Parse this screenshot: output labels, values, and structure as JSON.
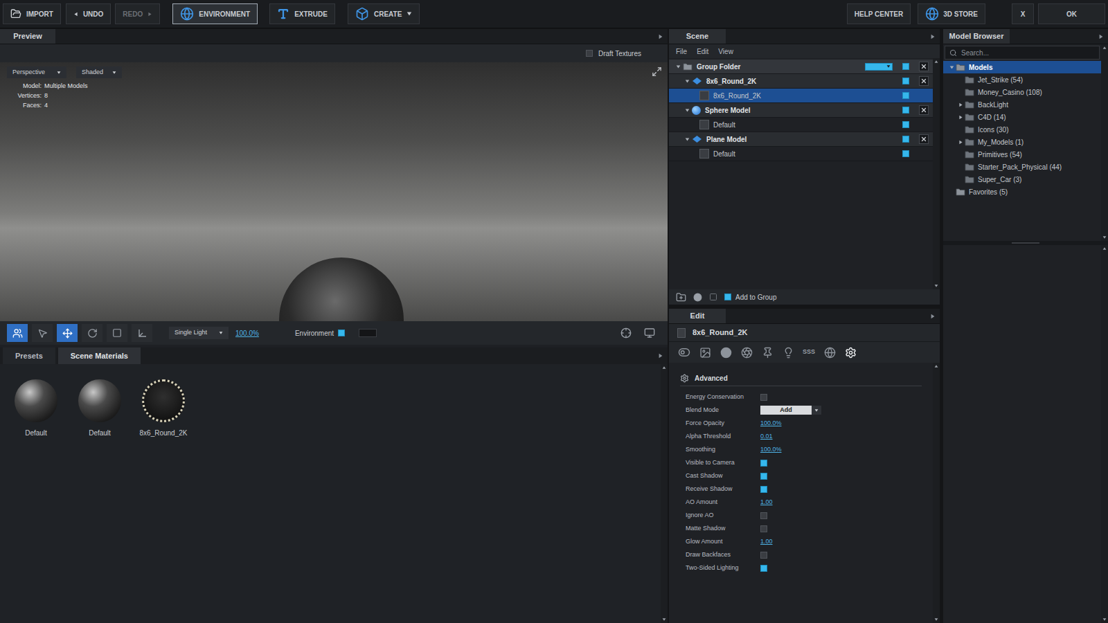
{
  "toolbar": {
    "left": [
      {
        "label": "IMPORT",
        "selected": false,
        "disabled": false,
        "dropdown": false
      },
      {
        "label": "UNDO",
        "selected": false,
        "disabled": false,
        "dropdown": false
      },
      {
        "label": "REDO",
        "selected": false,
        "disabled": true,
        "dropdown": false
      },
      {
        "label": "ENVIRONMENT",
        "selected": true,
        "disabled": false,
        "dropdown": false
      },
      {
        "label": "EXTRUDE",
        "selected": false,
        "disabled": false,
        "dropdown": false
      },
      {
        "label": "CREATE",
        "selected": false,
        "disabled": false,
        "dropdown": true
      }
    ],
    "right": [
      {
        "label": "HELP CENTER"
      },
      {
        "label": "3D STORE"
      },
      {
        "label": "X"
      },
      {
        "label": "OK"
      }
    ]
  },
  "preview": {
    "tab": "Preview",
    "draft_textures": {
      "label": "Draft Textures",
      "checked": false
    },
    "view_mode": "Perspective",
    "shading": "Shaded",
    "info": [
      {
        "label": "Model:",
        "value": "Multiple Models"
      },
      {
        "label": "Vertices:",
        "value": "8"
      },
      {
        "label": "Faces:",
        "value": "4"
      }
    ],
    "tools": [
      {
        "selected": true
      },
      {
        "selected": false
      },
      {
        "selected": true
      },
      {
        "selected": false
      },
      {
        "selected": false
      },
      {
        "selected": false
      }
    ],
    "light": "Single Light",
    "light_intensity": "100.0%",
    "environment": {
      "label": "Environment",
      "checked": true
    }
  },
  "materials": {
    "tabs": [
      {
        "label": "Presets",
        "selected": false
      },
      {
        "label": "Scene Materials",
        "selected": true
      }
    ],
    "items": [
      {
        "name": "Default"
      },
      {
        "name": "Default"
      },
      {
        "name": "8x6_Round_2K"
      }
    ]
  },
  "scene": {
    "tab": "Scene",
    "menu": [
      "File",
      "Edit",
      "View"
    ],
    "rows": [
      {
        "label": "Group Folder",
        "kind": "folder",
        "level": 0,
        "expandable": true,
        "expanded": true,
        "selected": false,
        "visible": true,
        "removable": true
      },
      {
        "label": "8x6_Round_2K",
        "kind": "plane",
        "level": 1,
        "expandable": true,
        "expanded": true,
        "selected": false,
        "visible": true,
        "removable": true
      },
      {
        "label": "8x6_Round_2K",
        "kind": "material",
        "level": 2,
        "expandable": false,
        "expanded": false,
        "selected": true,
        "visible": true,
        "removable": false
      },
      {
        "label": "Sphere Model",
        "kind": "sphere",
        "level": 1,
        "expandable": true,
        "expanded": true,
        "selected": false,
        "visible": true,
        "removable": true
      },
      {
        "label": "Default",
        "kind": "material",
        "level": 2,
        "expandable": false,
        "expanded": false,
        "selected": false,
        "visible": true,
        "removable": false
      },
      {
        "label": "Plane Model",
        "kind": "plane",
        "level": 1,
        "expandable": true,
        "expanded": true,
        "selected": false,
        "visible": true,
        "removable": true
      },
      {
        "label": "Default",
        "kind": "material",
        "level": 2,
        "expandable": false,
        "expanded": false,
        "selected": false,
        "visible": true,
        "removable": false
      }
    ],
    "add_to_group": {
      "label": "Add to Group",
      "checked": true
    }
  },
  "edit": {
    "tab": "Edit",
    "title": "8x6_Round_2K",
    "icon_tabs": [
      {
        "kind": "icon",
        "selected": false
      },
      {
        "kind": "icon",
        "selected": false
      },
      {
        "kind": "icon",
        "selected": false
      },
      {
        "kind": "icon",
        "selected": false
      },
      {
        "kind": "icon",
        "selected": false
      },
      {
        "kind": "icon",
        "selected": false
      },
      {
        "kind": "text",
        "label": "SSS",
        "selected": false
      },
      {
        "kind": "icon",
        "selected": false
      },
      {
        "kind": "icon",
        "selected": true
      }
    ],
    "section": "Advanced",
    "properties": [
      {
        "label": "Energy Conservation",
        "kind": "checkbox",
        "checked": false
      },
      {
        "label": "Blend Mode",
        "kind": "dropdown",
        "value": "Add"
      },
      {
        "label": "Force Opacity",
        "kind": "value",
        "value": "100.0%"
      },
      {
        "label": "Alpha Threshold",
        "kind": "value",
        "value": "0.01"
      },
      {
        "label": "Smoothing",
        "kind": "value",
        "value": "100.0%"
      },
      {
        "label": "Visible to Camera",
        "kind": "checkbox",
        "checked": true
      },
      {
        "label": "Cast Shadow",
        "kind": "checkbox",
        "checked": true
      },
      {
        "label": "Receive Shadow",
        "kind": "checkbox",
        "checked": true
      },
      {
        "label": "AO Amount",
        "kind": "value",
        "value": "1.00"
      },
      {
        "label": "Ignore AO",
        "kind": "checkbox",
        "checked": false
      },
      {
        "label": "Matte Shadow",
        "kind": "checkbox",
        "checked": false
      },
      {
        "label": "Glow Amount",
        "kind": "value",
        "value": "1.00"
      },
      {
        "label": "Draw Backfaces",
        "kind": "checkbox",
        "checked": false
      },
      {
        "label": "Two-Sided Lighting",
        "kind": "checkbox",
        "checked": true
      }
    ]
  },
  "model_browser": {
    "tab": "Model Browser",
    "search": {
      "placeholder": "Search..."
    },
    "items": [
      {
        "label": "Models",
        "level": 0,
        "expandable": true,
        "expanded": true,
        "selected": true
      },
      {
        "label": "Jet_Strike (54)",
        "level": 1,
        "expandable": false,
        "expanded": false,
        "selected": false
      },
      {
        "label": "Money_Casino (108)",
        "level": 1,
        "expandable": false,
        "expanded": false,
        "selected": false
      },
      {
        "label": "BackLight",
        "level": 1,
        "expandable": true,
        "expanded": false,
        "selected": false
      },
      {
        "label": "C4D (14)",
        "level": 1,
        "expandable": true,
        "expanded": false,
        "selected": false
      },
      {
        "label": "Icons (30)",
        "level": 1,
        "expandable": false,
        "expanded": false,
        "selected": false
      },
      {
        "label": "My_Models (1)",
        "level": 1,
        "expandable": true,
        "expanded": false,
        "selected": false
      },
      {
        "label": "Primitives (54)",
        "level": 1,
        "expandable": false,
        "expanded": false,
        "selected": false
      },
      {
        "label": "Starter_Pack_Physical (44)",
        "level": 1,
        "expandable": false,
        "expanded": false,
        "selected": false
      },
      {
        "label": "Super_Car (3)",
        "level": 1,
        "expandable": false,
        "expanded": false,
        "selected": false
      },
      {
        "label": "Favorites (5)",
        "level": 0,
        "expandable": false,
        "expanded": false,
        "selected": false
      }
    ]
  }
}
